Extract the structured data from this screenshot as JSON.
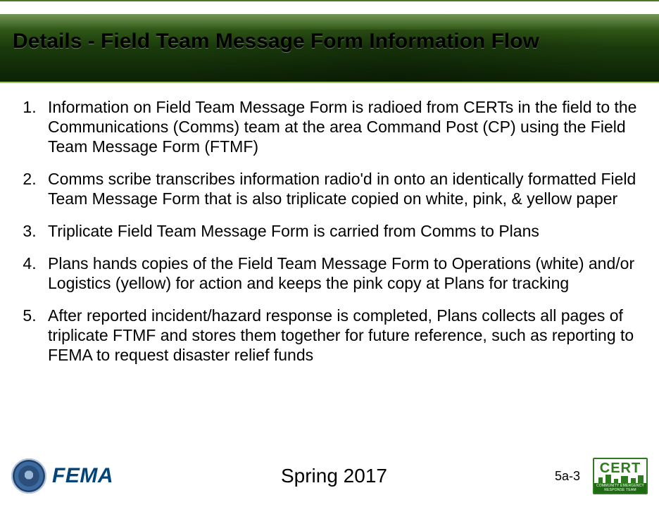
{
  "title": "Details - Field Team Message Form Information Flow",
  "items": [
    "Information on Field Team Message Form is radioed from CERTs in the field to the Communications (Comms) team at the area Command Post (CP) using the Field Team Message Form (FTMF)",
    "Comms scribe transcribes information radio'd in onto an identically formatted Field Team Message Form that is also triplicate copied on white, pink, & yellow paper",
    "Triplicate Field Team Message Form is carried from Comms to Plans",
    "Plans hands copies of the Field Team Message Form to Operations (white) and/or Logistics (yellow) for action and keeps the pink copy at Plans for tracking",
    "After reported incident/hazard response is completed, Plans collects all pages of triplicate FTMF and stores them together for future reference, such as reporting to FEMA to request disaster relief funds"
  ],
  "footer": {
    "left_org": "FEMA",
    "center": "Spring 2017",
    "page": "5a-3",
    "cert_abbrev": "CERT",
    "cert_full": "COMMUNITY EMERGENCY RESPONSE TEAM"
  }
}
